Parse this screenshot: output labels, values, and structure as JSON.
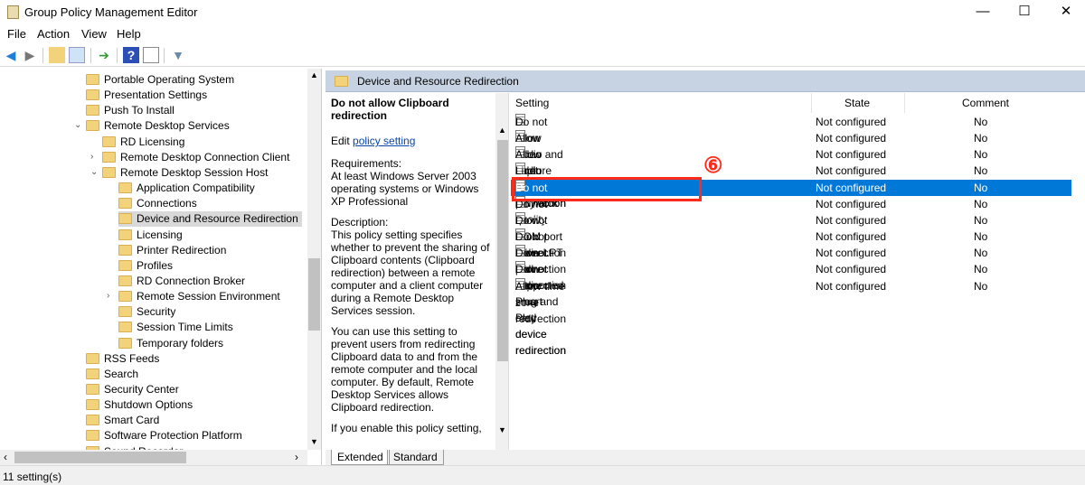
{
  "window": {
    "title": "Group Policy Management Editor",
    "minimize": "—",
    "maximize": "☐",
    "close": "✕"
  },
  "menu": [
    "File",
    "Action",
    "View",
    "Help"
  ],
  "toolbar": [
    "back-icon",
    "forward-icon",
    "up-folder-icon",
    "show-hide-tree-icon",
    "export-list-icon",
    "help-icon",
    "show-hide-action-pane-icon",
    "filter-icon"
  ],
  "tree": [
    {
      "label": "Portable Operating System",
      "level": 1
    },
    {
      "label": "Presentation Settings",
      "level": 1
    },
    {
      "label": "Push To Install",
      "level": 1
    },
    {
      "label": "Remote Desktop Services",
      "level": 1,
      "expander": "expanded"
    },
    {
      "label": "RD Licensing",
      "level": 2
    },
    {
      "label": "Remote Desktop Connection Client",
      "level": 2,
      "expander": "collapsed"
    },
    {
      "label": "Remote Desktop Session Host",
      "level": 2,
      "expander": "expanded"
    },
    {
      "label": "Application Compatibility",
      "level": 3
    },
    {
      "label": "Connections",
      "level": 3
    },
    {
      "label": "Device and Resource Redirection",
      "level": 3,
      "selected": true
    },
    {
      "label": "Licensing",
      "level": 3
    },
    {
      "label": "Printer Redirection",
      "level": 3
    },
    {
      "label": "Profiles",
      "level": 3
    },
    {
      "label": "RD Connection Broker",
      "level": 3
    },
    {
      "label": "Remote Session Environment",
      "level": 3,
      "expander": "collapsed"
    },
    {
      "label": "Security",
      "level": 3
    },
    {
      "label": "Session Time Limits",
      "level": 3
    },
    {
      "label": "Temporary folders",
      "level": 3
    },
    {
      "label": "RSS Feeds",
      "level": 1
    },
    {
      "label": "Search",
      "level": 1
    },
    {
      "label": "Security Center",
      "level": 1
    },
    {
      "label": "Shutdown Options",
      "level": 1
    },
    {
      "label": "Smart Card",
      "level": 1
    },
    {
      "label": "Software Protection Platform",
      "level": 1
    },
    {
      "label": "Sound Recorder",
      "level": 1
    }
  ],
  "right": {
    "header": "Device and Resource Redirection",
    "desc": {
      "title": "Do not allow Clipboard redirection",
      "edit_prefix": "Edit ",
      "edit_link": "policy setting ",
      "requirements": "Requirements:\nAt least Windows Server 2003 operating systems or Windows XP Professional",
      "description": "Description:\nThis policy setting specifies whether to prevent the sharing of Clipboard contents (Clipboard redirection) between a remote computer and a client computer during a Remote Desktop Services session.",
      "para2": "You can use this setting to prevent users from redirecting Clipboard data to and from the remote computer and the local computer. By default, Remote Desktop Services allows Clipboard redirection.",
      "para3": "If you enable this policy setting,"
    },
    "columns": {
      "setting": "Setting",
      "state": "State",
      "comment": "Comment"
    },
    "rows": [
      {
        "setting": "Do not allow video capture redirection",
        "state": "Not configured",
        "comment": "No"
      },
      {
        "setting": "Allow audio and video playback redirection",
        "state": "Not configured",
        "comment": "No"
      },
      {
        "setting": "Allow audio recording redirection",
        "state": "Not configured",
        "comment": "No"
      },
      {
        "setting": "Limit audio playback quality",
        "state": "Not configured",
        "comment": "No"
      },
      {
        "setting": "Do not allow Clipboard redirection",
        "state": "Not configured",
        "comment": "No",
        "selected": true
      },
      {
        "setting": "Do not allow COM port redirection",
        "state": "Not configured",
        "comment": "No"
      },
      {
        "setting": "Do not allow drive redirection",
        "state": "Not configured",
        "comment": "No"
      },
      {
        "setting": "Do not allow LPT port redirection",
        "state": "Not configured",
        "comment": "No"
      },
      {
        "setting": "Do not allow supported Plug and Play device redirection",
        "state": "Not configured",
        "comment": "No"
      },
      {
        "setting": "Do not allow smart card device redirection",
        "state": "Not configured",
        "comment": "No"
      },
      {
        "setting": "Allow time zone redirection",
        "state": "Not configured",
        "comment": "No"
      }
    ],
    "annotation": "⑥",
    "tabs": [
      "Extended",
      "Standard"
    ]
  },
  "status": "11 setting(s)",
  "colors": {
    "selection": "#0078d7",
    "highlight_box": "#ff2a1a",
    "header_band": "#c7d3e3"
  }
}
